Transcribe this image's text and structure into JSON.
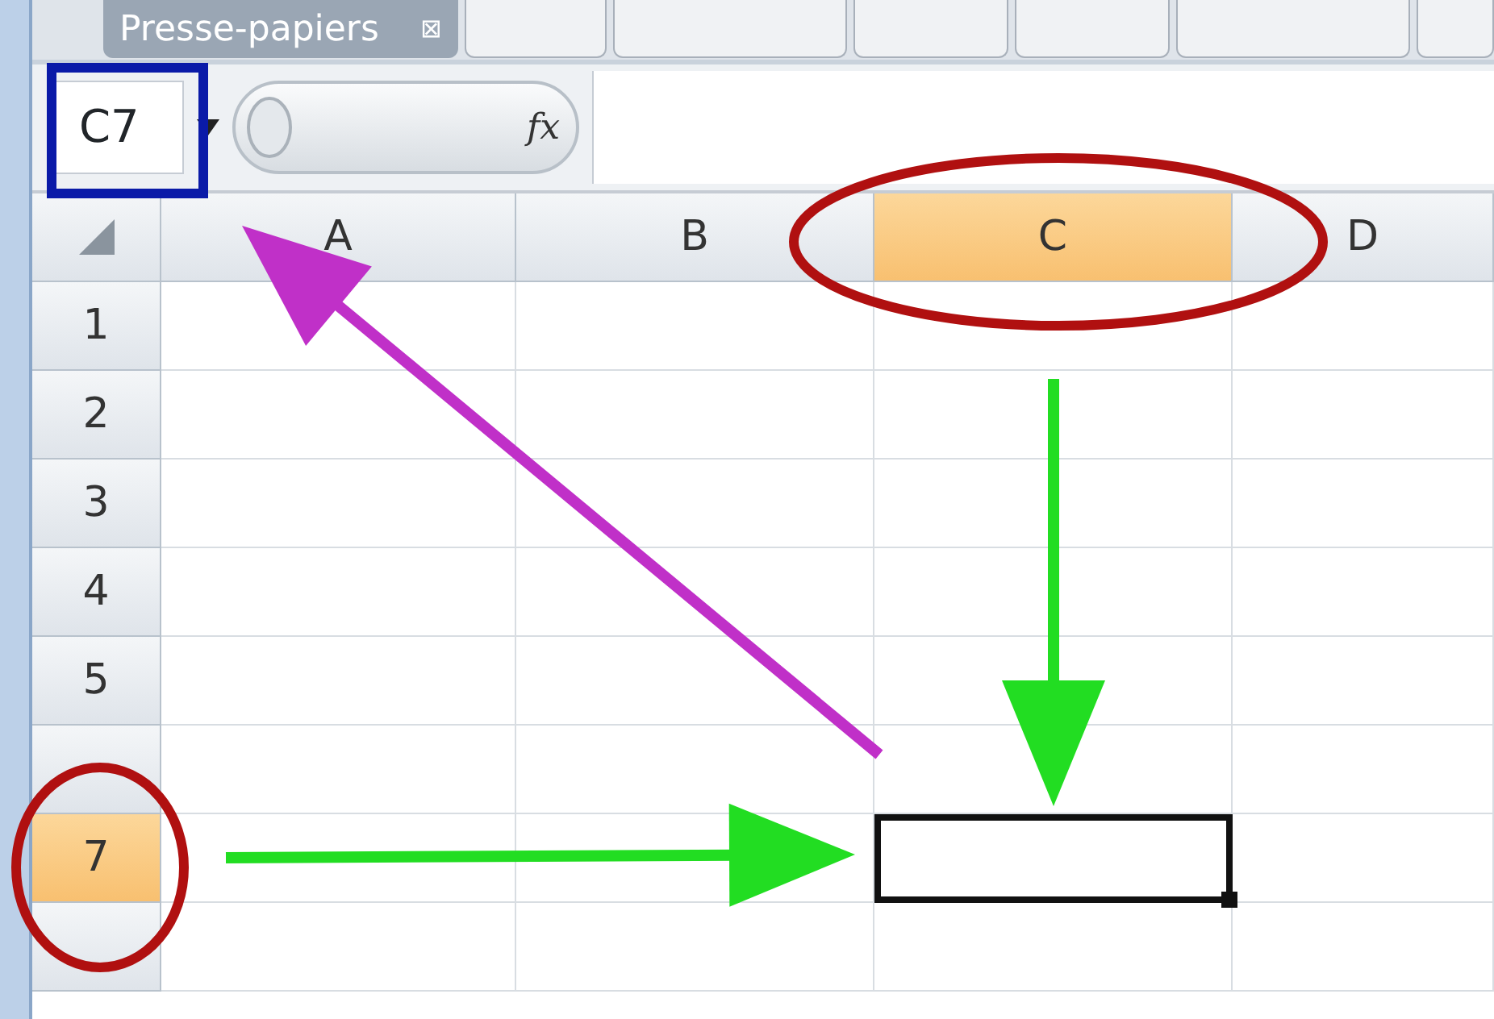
{
  "ribbon": {
    "group_label": "Presse-papiers",
    "close_glyph": "⊠"
  },
  "name_box": {
    "value": "C7"
  },
  "formula_bar": {
    "function_label": "fx"
  },
  "columns": [
    {
      "label": "A",
      "selected": false
    },
    {
      "label": "B",
      "selected": false
    },
    {
      "label": "C",
      "selected": true
    },
    {
      "label": "D",
      "selected": false
    }
  ],
  "rows": [
    {
      "label": "1",
      "selected": false
    },
    {
      "label": "2",
      "selected": false
    },
    {
      "label": "3",
      "selected": false
    },
    {
      "label": "4",
      "selected": false
    },
    {
      "label": "5",
      "selected": false
    },
    {
      "selected": false
    },
    {
      "label": "7",
      "selected": true
    },
    {
      "selected": false
    }
  ],
  "annotations": [
    {
      "kind": "box",
      "color": "#0a1aa8"
    },
    {
      "kind": "ellipse",
      "color": "#b01010"
    },
    {
      "kind": "ellipse",
      "color": "#b01010"
    },
    {
      "kind": "arrow",
      "color": "#c030c8"
    },
    {
      "kind": "arrow",
      "color": "#22dd22"
    },
    {
      "kind": "arrow",
      "color": "#22dd22"
    }
  ]
}
